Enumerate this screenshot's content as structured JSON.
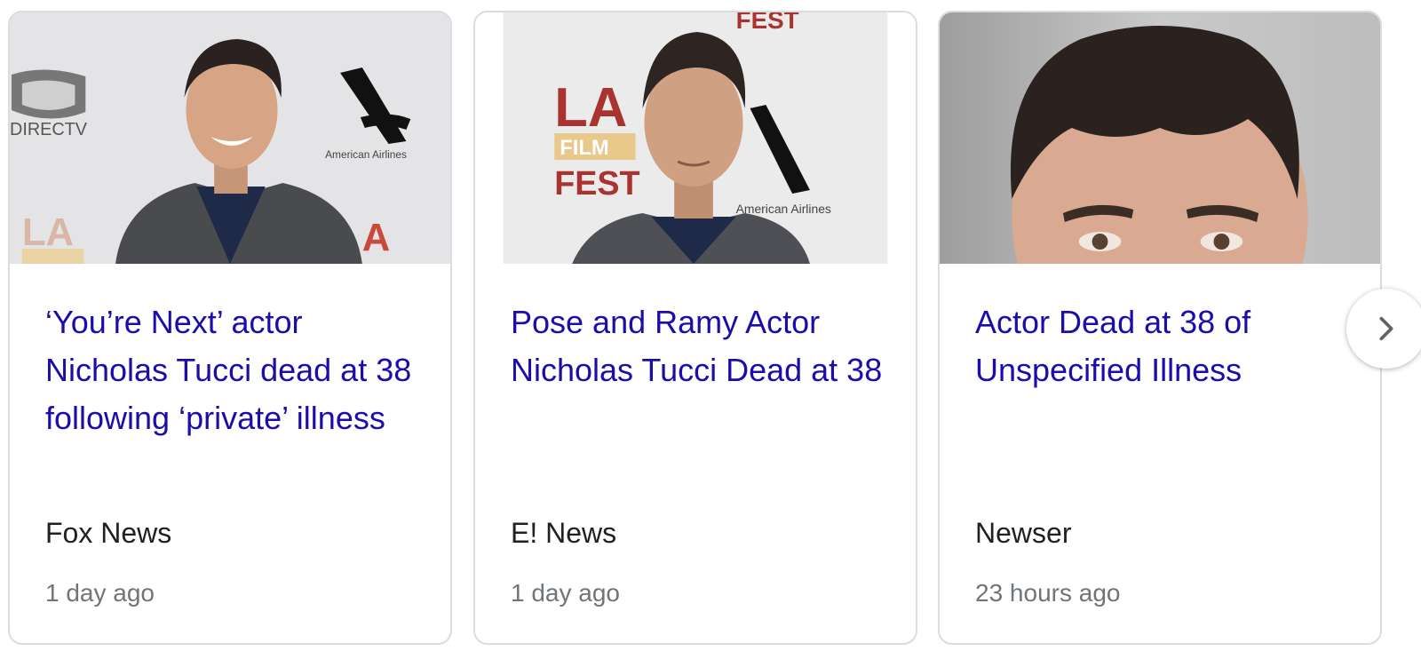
{
  "articles": [
    {
      "headline": "‘You’re Next’ actor Nicholas Tucci dead at 38 following ‘private’ illness",
      "source": "Fox News",
      "age": "1 day ago",
      "thumbnail": {
        "backdrop_logos": [
          "DIRECTV",
          "American Airlines",
          "LA"
        ]
      }
    },
    {
      "headline": "Pose and Ramy Actor Nicholas Tucci Dead at 38",
      "source": "E! News",
      "age": "1 day ago",
      "thumbnail": {
        "backdrop_logos": [
          "LA",
          "FILM",
          "FEST",
          "American Airlines"
        ]
      }
    },
    {
      "headline": "Actor Dead at 38 of Unspecified Illness",
      "source": "Newser",
      "age": "23 hours ago",
      "thumbnail": {
        "backdrop_logos": []
      }
    }
  ],
  "colors": {
    "headline": "#1a0dab",
    "source": "#202124",
    "age": "#70757a",
    "card_border": "#dadce0"
  },
  "icons": {
    "next": "chevron-right-icon"
  }
}
